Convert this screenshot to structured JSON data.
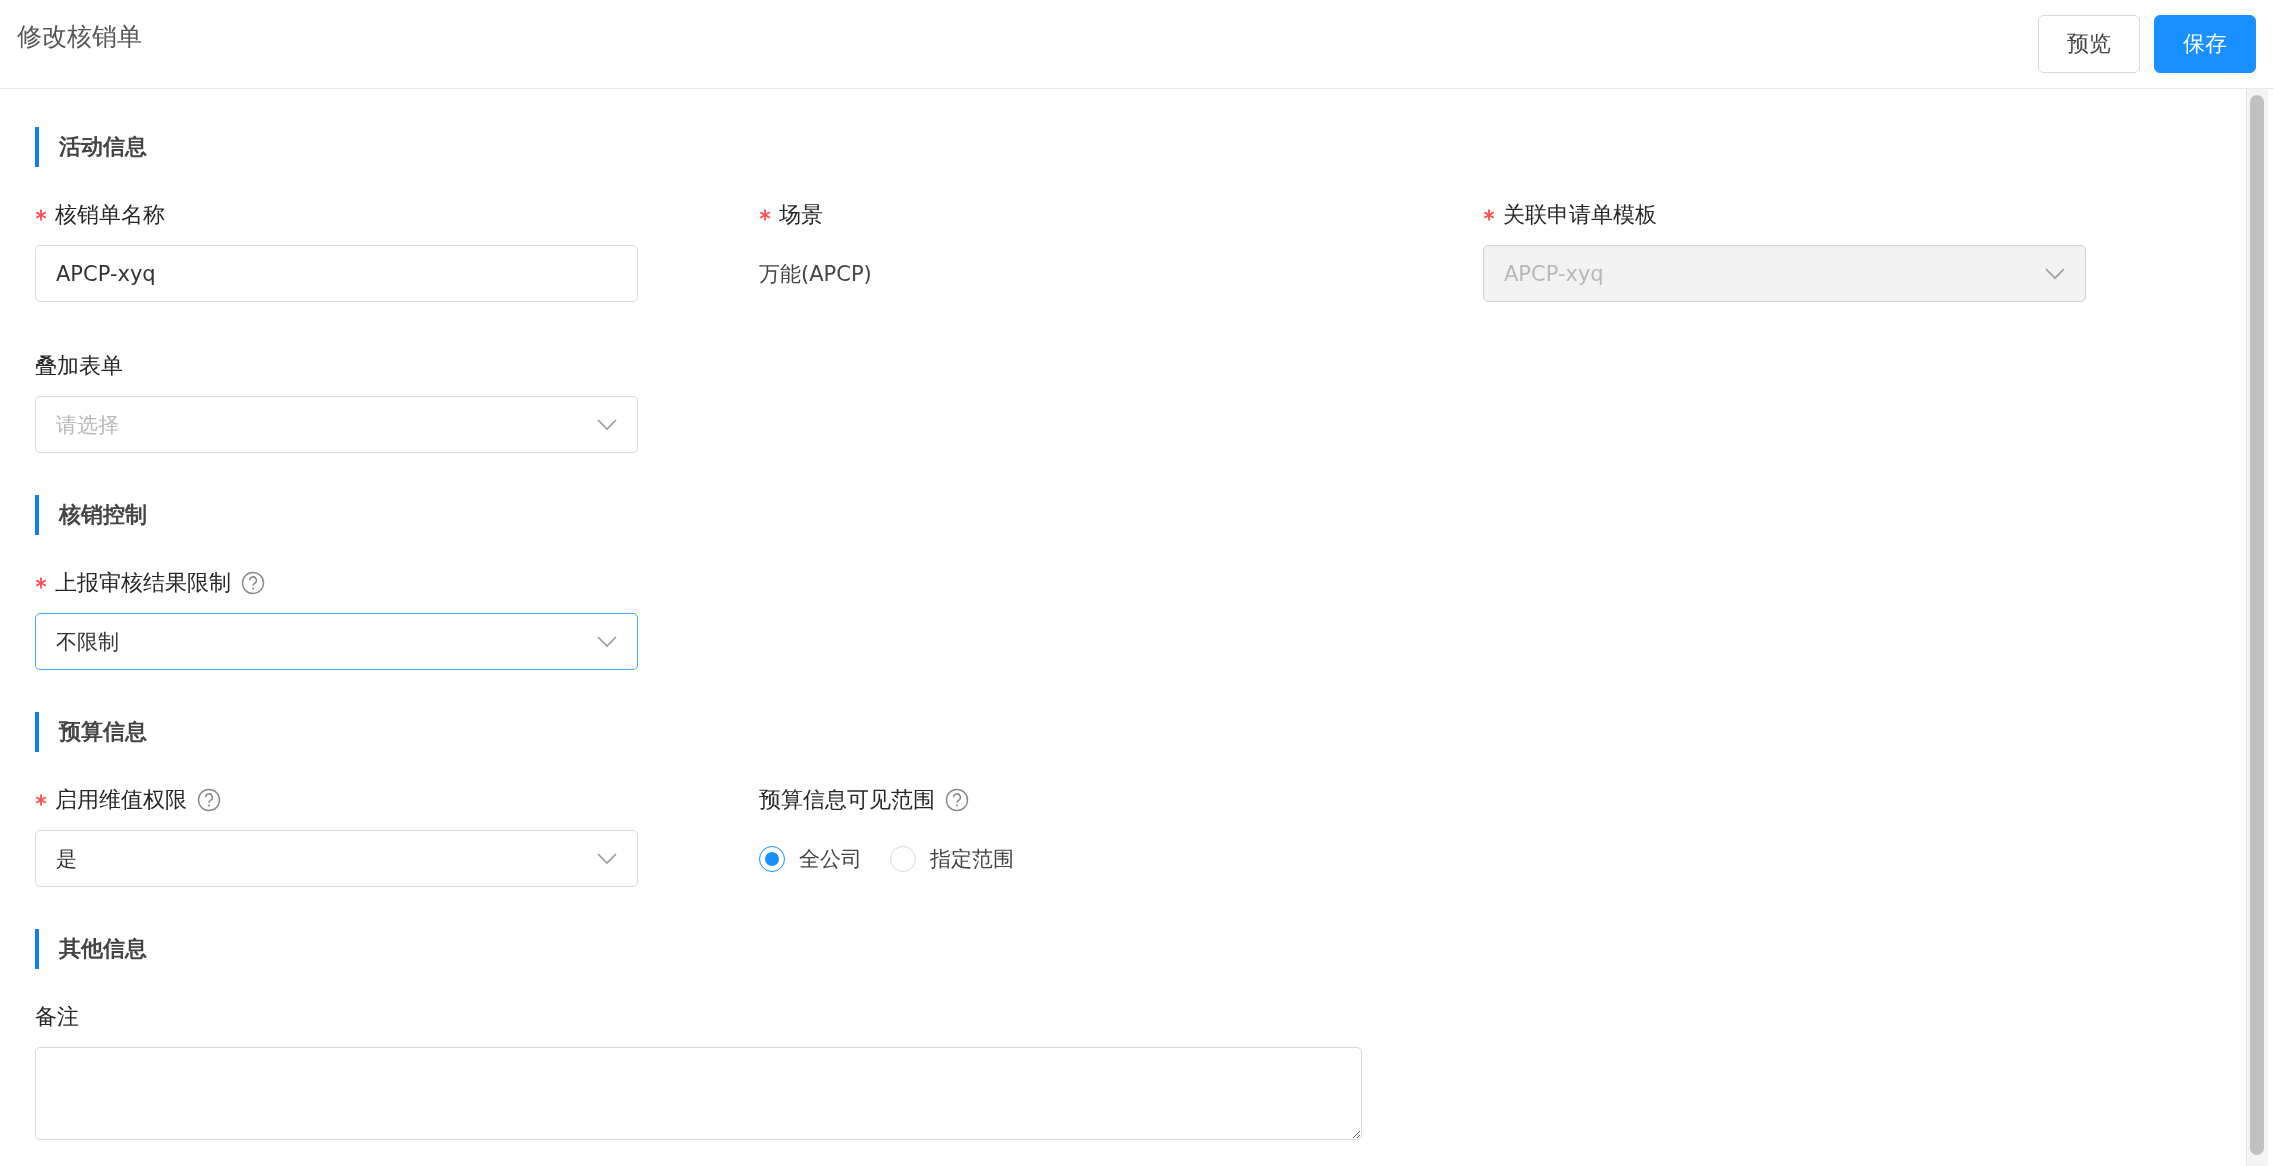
{
  "header": {
    "title": "修改核销单",
    "buttons": [
      {
        "label": "预览",
        "kind": "default"
      },
      {
        "label": "保存",
        "kind": "primary"
      }
    ]
  },
  "sections": [
    {
      "title": "活动信息",
      "fields": [
        {
          "kind": "text",
          "label": "核销单名称",
          "required": true,
          "help": false,
          "value": "APCP-xyq"
        },
        {
          "kind": "static",
          "label": "场景",
          "required": true,
          "help": false,
          "value": "万能(APCP)"
        },
        {
          "kind": "select",
          "label": "关联申请单模板",
          "required": true,
          "help": false,
          "value": "APCP-xyq",
          "disabled": true,
          "focused": false
        },
        {
          "kind": "select",
          "label": "叠加表单",
          "required": false,
          "help": false,
          "placeholder": "请选择",
          "disabled": false,
          "focused": false
        }
      ]
    },
    {
      "title": "核销控制",
      "fields": [
        {
          "kind": "select",
          "label": "上报审核结果限制",
          "required": true,
          "help": true,
          "value": "不限制",
          "disabled": false,
          "focused": true
        }
      ]
    },
    {
      "title": "预算信息",
      "fields": [
        {
          "kind": "select",
          "label": "启用维值权限",
          "required": true,
          "help": true,
          "value": "是",
          "disabled": false,
          "focused": false
        },
        {
          "kind": "radio",
          "label": "预算信息可见范围",
          "required": false,
          "help": true,
          "options": [
            {
              "label": "全公司",
              "selected": true
            },
            {
              "label": "指定范围",
              "selected": false
            }
          ]
        }
      ]
    },
    {
      "title": "其他信息",
      "fields": [
        {
          "kind": "textarea",
          "label": "备注",
          "required": false,
          "help": false
        }
      ]
    }
  ]
}
